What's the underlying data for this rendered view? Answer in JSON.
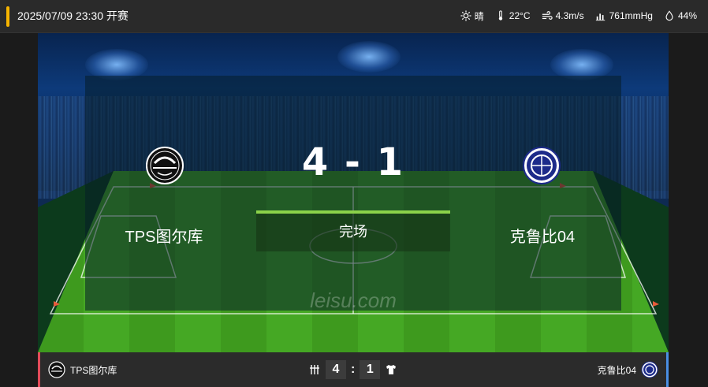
{
  "header": {
    "datetime": "2025/07/09 23:30 开赛",
    "weather": {
      "condition": "晴",
      "temperature": "22°C",
      "wind": "4.3m/s",
      "pressure": "761mmHg",
      "humidity": "44%"
    }
  },
  "match": {
    "score": "4 - 1",
    "status": "完场",
    "home_team": "TPS图尔库",
    "away_team": "克鲁比04",
    "watermark": "leisu.com"
  },
  "bottom": {
    "home_team": "TPS图尔库",
    "away_team": "克鲁比04",
    "home_score": "4",
    "away_score": "1",
    "separator": ":"
  },
  "colors": {
    "accent": "#f6b400",
    "home_side": "#e34b5a",
    "away_side": "#4a8fe3",
    "status_bar": "#8bd24a"
  }
}
